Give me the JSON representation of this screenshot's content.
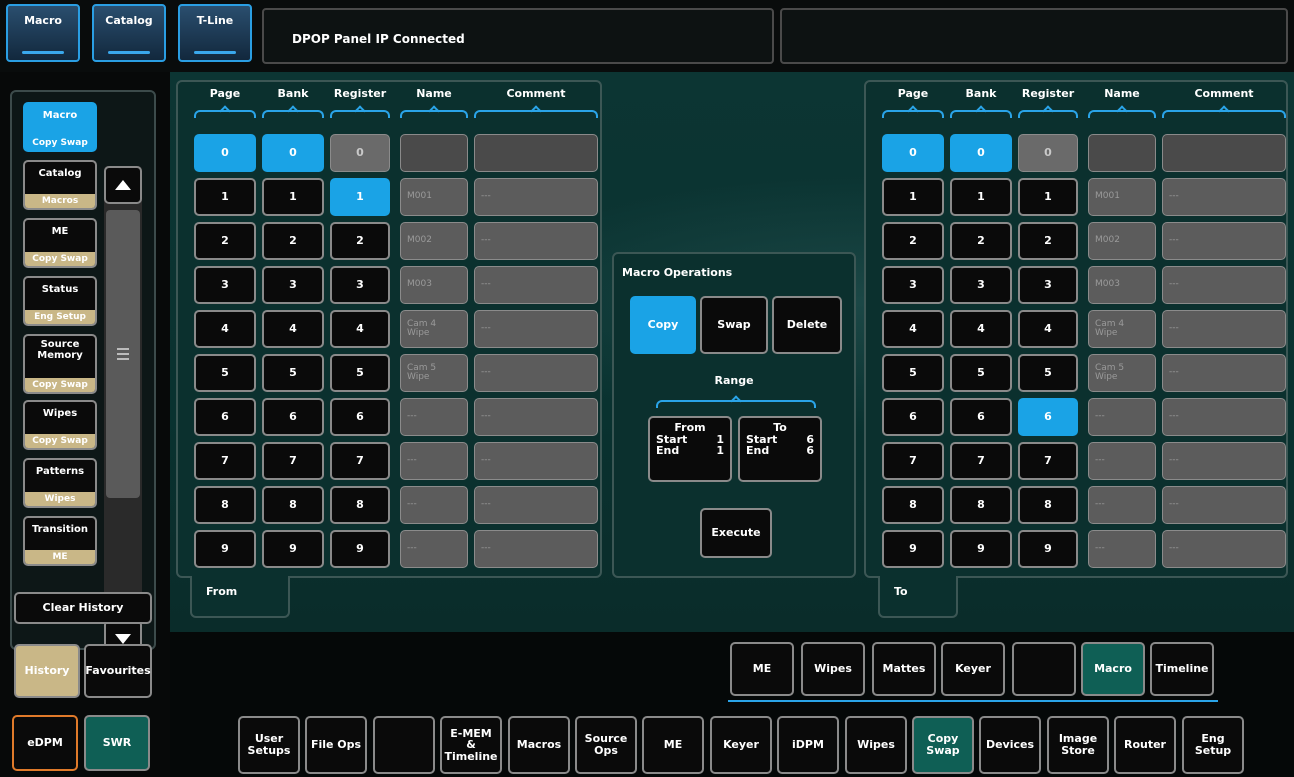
{
  "top_tabs": [
    {
      "label": "Macro"
    },
    {
      "label": "Catalog"
    },
    {
      "label": "T-Line"
    }
  ],
  "status_message": "DPOP Panel IP Connected",
  "history_list": [
    {
      "top": "Macro",
      "bottom": "Copy Swap",
      "selected": true
    },
    {
      "top": "Catalog",
      "bottom": "Macros",
      "selected": false
    },
    {
      "top": "ME",
      "bottom": "Copy Swap",
      "selected": false
    },
    {
      "top": "Status",
      "bottom": "Eng Setup",
      "selected": false
    },
    {
      "top": "Source Memory",
      "bottom": "Copy Swap",
      "selected": false
    },
    {
      "top": "Wipes",
      "bottom": "Copy Swap",
      "selected": false
    },
    {
      "top": "Patterns",
      "bottom": "Wipes",
      "selected": false
    },
    {
      "top": "Transition",
      "bottom": "ME",
      "selected": false
    }
  ],
  "clear_history_label": "Clear History",
  "history_tab_label": "History",
  "favourites_tab_label": "Favourites",
  "edpm_label": "eDPM",
  "swr_label": "SWR",
  "table_headers": [
    "Page",
    "Bank",
    "Register",
    "Name",
    "Comment"
  ],
  "from_rows": [
    {
      "page": "0",
      "bank": "0",
      "register": "0",
      "name": "",
      "comment": ""
    },
    {
      "page": "1",
      "bank": "1",
      "register": "1",
      "name": "M001",
      "comment": "---"
    },
    {
      "page": "2",
      "bank": "2",
      "register": "2",
      "name": "M002",
      "comment": "---"
    },
    {
      "page": "3",
      "bank": "3",
      "register": "3",
      "name": "M003",
      "comment": "---"
    },
    {
      "page": "4",
      "bank": "4",
      "register": "4",
      "name": "Cam 4 Wipe",
      "comment": "---"
    },
    {
      "page": "5",
      "bank": "5",
      "register": "5",
      "name": "Cam 5 Wipe",
      "comment": "---"
    },
    {
      "page": "6",
      "bank": "6",
      "register": "6",
      "name": "---",
      "comment": "---"
    },
    {
      "page": "7",
      "bank": "7",
      "register": "7",
      "name": "---",
      "comment": "---"
    },
    {
      "page": "8",
      "bank": "8",
      "register": "8",
      "name": "---",
      "comment": "---"
    },
    {
      "page": "9",
      "bank": "9",
      "register": "9",
      "name": "---",
      "comment": "---"
    }
  ],
  "to_rows": [
    {
      "page": "0",
      "bank": "0",
      "register": "0",
      "name": "",
      "comment": ""
    },
    {
      "page": "1",
      "bank": "1",
      "register": "1",
      "name": "M001",
      "comment": "---"
    },
    {
      "page": "2",
      "bank": "2",
      "register": "2",
      "name": "M002",
      "comment": "---"
    },
    {
      "page": "3",
      "bank": "3",
      "register": "3",
      "name": "M003",
      "comment": "---"
    },
    {
      "page": "4",
      "bank": "4",
      "register": "4",
      "name": "Cam 4 Wipe",
      "comment": "---"
    },
    {
      "page": "5",
      "bank": "5",
      "register": "5",
      "name": "Cam 5 Wipe",
      "comment": "---"
    },
    {
      "page": "6",
      "bank": "6",
      "register": "6",
      "name": "---",
      "comment": "---"
    },
    {
      "page": "7",
      "bank": "7",
      "register": "7",
      "name": "---",
      "comment": "---"
    },
    {
      "page": "8",
      "bank": "8",
      "register": "8",
      "name": "---",
      "comment": "---"
    },
    {
      "page": "9",
      "bank": "9",
      "register": "9",
      "name": "---",
      "comment": "---"
    }
  ],
  "from_selected": {
    "page": "0",
    "bank": "0",
    "register": "1"
  },
  "to_selected": {
    "page": "0",
    "bank": "0",
    "register": "6"
  },
  "from_tab_label": "From",
  "to_tab_label": "To",
  "macro_ops": {
    "title": "Macro Operations",
    "copy": "Copy",
    "swap": "Swap",
    "delete": "Delete",
    "active": "Copy",
    "range_label": "Range",
    "from_box": {
      "title": "From",
      "start_label": "Start",
      "start": "1",
      "end_label": "End",
      "end": "1"
    },
    "to_box": {
      "title": "To",
      "start_label": "Start",
      "start": "6",
      "end_label": "End",
      "end": "6"
    },
    "execute": "Execute"
  },
  "sub_tabs": [
    {
      "label": "ME",
      "active": false
    },
    {
      "label": "Wipes",
      "active": false
    },
    {
      "label": "Mattes",
      "active": false
    },
    {
      "label": "Keyer",
      "active": false
    },
    {
      "label": "",
      "active": false
    },
    {
      "label": "Macro",
      "active": true
    },
    {
      "label": "Timeline",
      "active": false
    }
  ],
  "bottom_tabs": [
    {
      "label": "User Setups",
      "active": false
    },
    {
      "label": "File Ops",
      "active": false
    },
    {
      "label": "",
      "active": false
    },
    {
      "label": "E-MEM & Timeline",
      "active": false
    },
    {
      "label": "Macros",
      "active": false
    },
    {
      "label": "Source Ops",
      "active": false
    },
    {
      "label": "ME",
      "active": false
    },
    {
      "label": "Keyer",
      "active": false
    },
    {
      "label": "iDPM",
      "active": false
    },
    {
      "label": "Wipes",
      "active": false
    },
    {
      "label": "Copy Swap",
      "active": true
    },
    {
      "label": "Devices",
      "active": false
    },
    {
      "label": "Image Store",
      "active": false
    },
    {
      "label": "Router",
      "active": false
    },
    {
      "label": "Eng Setup",
      "active": false
    }
  ],
  "colors": {
    "accent_blue": "#1aa3e6",
    "teal_active": "#0f5f55",
    "tan_active": "#c9b787",
    "orange_outline": "#e07a2a"
  }
}
